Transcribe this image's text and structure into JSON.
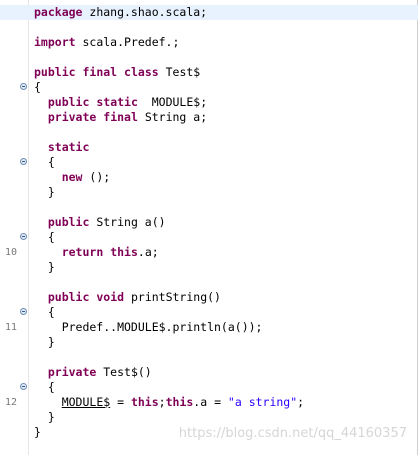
{
  "editor": {
    "lines": [
      {
        "num": "",
        "fold": false,
        "highlight": true,
        "tokens": [
          {
            "t": "package",
            "k": "kw"
          },
          {
            "t": " zhang.shao.scala;",
            "k": ""
          }
        ]
      },
      {
        "num": "",
        "fold": false,
        "highlight": false,
        "tokens": []
      },
      {
        "num": "",
        "fold": false,
        "highlight": false,
        "tokens": [
          {
            "t": "import",
            "k": "kw"
          },
          {
            "t": " scala.Predef.;",
            "k": ""
          }
        ]
      },
      {
        "num": "",
        "fold": false,
        "highlight": false,
        "tokens": []
      },
      {
        "num": "",
        "fold": false,
        "highlight": false,
        "tokens": [
          {
            "t": "public",
            "k": "kw"
          },
          {
            "t": " ",
            "k": ""
          },
          {
            "t": "final",
            "k": "kw"
          },
          {
            "t": " ",
            "k": ""
          },
          {
            "t": "class",
            "k": "kw"
          },
          {
            "t": " Test$",
            "k": ""
          }
        ]
      },
      {
        "num": "",
        "fold": true,
        "highlight": false,
        "tokens": [
          {
            "t": "{",
            "k": ""
          }
        ]
      },
      {
        "num": "",
        "fold": false,
        "highlight": false,
        "tokens": [
          {
            "t": "  ",
            "k": ""
          },
          {
            "t": "public",
            "k": "kw"
          },
          {
            "t": " ",
            "k": ""
          },
          {
            "t": "static",
            "k": "kw"
          },
          {
            "t": "  MODULE$;",
            "k": ""
          }
        ]
      },
      {
        "num": "",
        "fold": false,
        "highlight": false,
        "tokens": [
          {
            "t": "  ",
            "k": ""
          },
          {
            "t": "private",
            "k": "kw"
          },
          {
            "t": " ",
            "k": ""
          },
          {
            "t": "final",
            "k": "kw"
          },
          {
            "t": " String a;",
            "k": ""
          }
        ]
      },
      {
        "num": "",
        "fold": false,
        "highlight": false,
        "tokens": []
      },
      {
        "num": "",
        "fold": false,
        "highlight": false,
        "tokens": [
          {
            "t": "  ",
            "k": ""
          },
          {
            "t": "static",
            "k": "kw"
          }
        ]
      },
      {
        "num": "",
        "fold": true,
        "highlight": false,
        "tokens": [
          {
            "t": "  {",
            "k": ""
          }
        ]
      },
      {
        "num": "",
        "fold": false,
        "highlight": false,
        "tokens": [
          {
            "t": "    ",
            "k": ""
          },
          {
            "t": "new",
            "k": "kw"
          },
          {
            "t": " ();",
            "k": ""
          }
        ]
      },
      {
        "num": "",
        "fold": false,
        "highlight": false,
        "tokens": [
          {
            "t": "  }",
            "k": ""
          }
        ]
      },
      {
        "num": "",
        "fold": false,
        "highlight": false,
        "tokens": []
      },
      {
        "num": "",
        "fold": false,
        "highlight": false,
        "tokens": [
          {
            "t": "  ",
            "k": ""
          },
          {
            "t": "public",
            "k": "kw"
          },
          {
            "t": " String a()",
            "k": ""
          }
        ]
      },
      {
        "num": "",
        "fold": true,
        "highlight": false,
        "tokens": [
          {
            "t": "  {",
            "k": ""
          }
        ]
      },
      {
        "num": "10",
        "fold": false,
        "highlight": false,
        "tokens": [
          {
            "t": "    ",
            "k": ""
          },
          {
            "t": "return",
            "k": "kw"
          },
          {
            "t": " ",
            "k": ""
          },
          {
            "t": "this",
            "k": "kw"
          },
          {
            "t": ".a;",
            "k": ""
          }
        ]
      },
      {
        "num": "",
        "fold": false,
        "highlight": false,
        "tokens": [
          {
            "t": "  }",
            "k": ""
          }
        ]
      },
      {
        "num": "",
        "fold": false,
        "highlight": false,
        "tokens": []
      },
      {
        "num": "",
        "fold": false,
        "highlight": false,
        "tokens": [
          {
            "t": "  ",
            "k": ""
          },
          {
            "t": "public",
            "k": "kw"
          },
          {
            "t": " ",
            "k": ""
          },
          {
            "t": "void",
            "k": "kw"
          },
          {
            "t": " printString()",
            "k": ""
          }
        ]
      },
      {
        "num": "",
        "fold": true,
        "highlight": false,
        "tokens": [
          {
            "t": "  {",
            "k": ""
          }
        ]
      },
      {
        "num": "11",
        "fold": false,
        "highlight": false,
        "tokens": [
          {
            "t": "    Predef..MODULE$.println(a());",
            "k": ""
          }
        ]
      },
      {
        "num": "",
        "fold": false,
        "highlight": false,
        "tokens": [
          {
            "t": "  }",
            "k": ""
          }
        ]
      },
      {
        "num": "",
        "fold": false,
        "highlight": false,
        "tokens": []
      },
      {
        "num": "",
        "fold": false,
        "highlight": false,
        "tokens": [
          {
            "t": "  ",
            "k": ""
          },
          {
            "t": "private",
            "k": "kw"
          },
          {
            "t": " Test$()",
            "k": ""
          }
        ]
      },
      {
        "num": "",
        "fold": true,
        "highlight": false,
        "tokens": [
          {
            "t": "  {",
            "k": ""
          }
        ]
      },
      {
        "num": "12",
        "fold": false,
        "highlight": false,
        "tokens": [
          {
            "t": "    ",
            "k": ""
          },
          {
            "t": "MODULE$",
            "k": "ul"
          },
          {
            "t": " = ",
            "k": ""
          },
          {
            "t": "this",
            "k": "kw"
          },
          {
            "t": ";",
            "k": ""
          },
          {
            "t": "this",
            "k": "kw"
          },
          {
            "t": ".a = ",
            "k": ""
          },
          {
            "t": "\"a string\"",
            "k": "str"
          },
          {
            "t": ";",
            "k": ""
          }
        ]
      },
      {
        "num": "",
        "fold": false,
        "highlight": false,
        "tokens": [
          {
            "t": "  }",
            "k": ""
          }
        ]
      },
      {
        "num": "",
        "fold": false,
        "highlight": false,
        "tokens": [
          {
            "t": "}",
            "k": ""
          }
        ]
      }
    ]
  },
  "watermark": "https://blog.csdn.net/qq_44160357"
}
